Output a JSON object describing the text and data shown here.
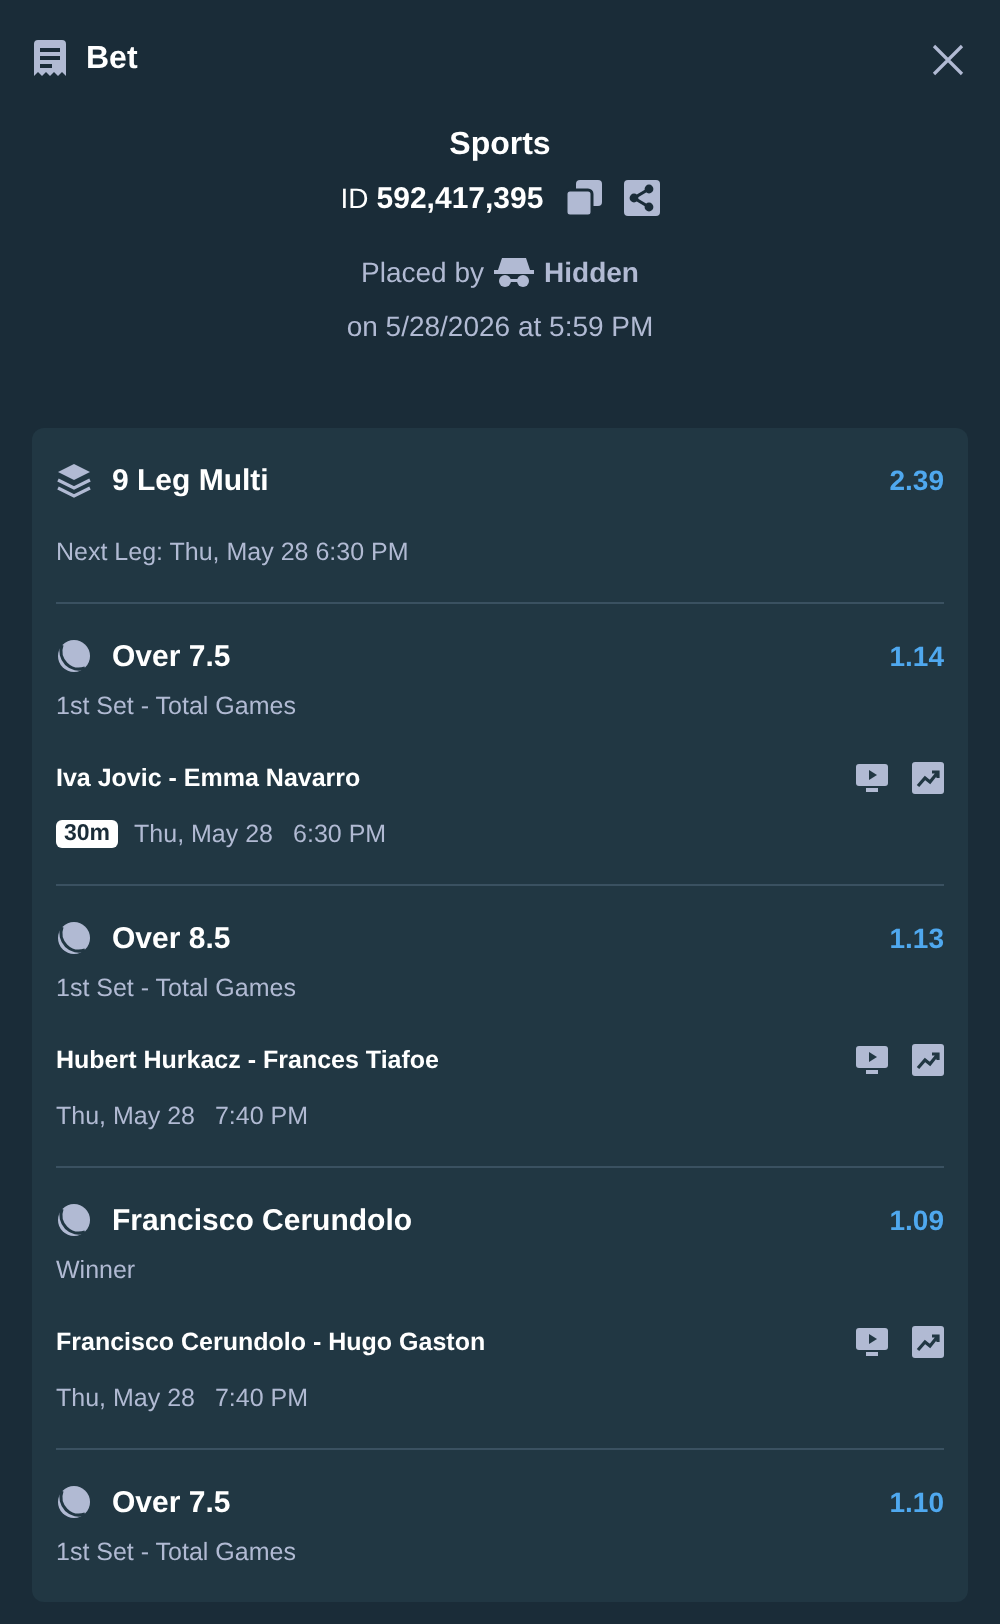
{
  "header": {
    "title": "Bet"
  },
  "bet": {
    "category": "Sports",
    "id_label": "ID",
    "id": "592,417,395",
    "placed_by_label": "Placed by",
    "placed_by": "Hidden",
    "placed_on": "on 5/28/2026 at 5:59 PM"
  },
  "multi": {
    "title": "9 Leg Multi",
    "odds": "2.39",
    "next_leg": "Next Leg: Thu, May 28 6:30 PM"
  },
  "legs": [
    {
      "selection": "Over 7.5",
      "odds": "1.14",
      "market": "1st Set - Total Games",
      "match": "Iva Jovic - Emma Navarro",
      "badge": "30m",
      "date": "Thu, May 28",
      "time": "6:30 PM"
    },
    {
      "selection": "Over 8.5",
      "odds": "1.13",
      "market": "1st Set - Total Games",
      "match": "Hubert Hurkacz - Frances Tiafoe",
      "date": "Thu, May 28",
      "time": "7:40 PM"
    },
    {
      "selection": "Francisco Cerundolo",
      "odds": "1.09",
      "market": "Winner",
      "match": "Francisco Cerundolo - Hugo Gaston",
      "date": "Thu, May 28",
      "time": "7:40 PM"
    },
    {
      "selection": "Over 7.5",
      "odds": "1.10",
      "market": "1st Set - Total Games"
    }
  ]
}
